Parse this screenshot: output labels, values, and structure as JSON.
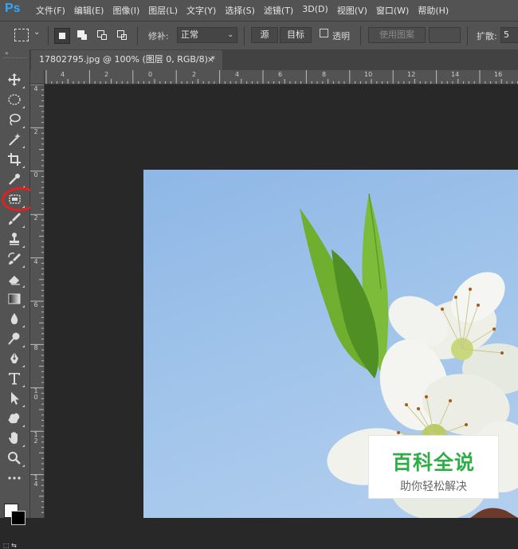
{
  "app": {
    "logo": "Ps"
  },
  "menu": [
    "文件(F)",
    "编辑(E)",
    "图像(I)",
    "图层(L)",
    "文字(Y)",
    "选择(S)",
    "滤镜(T)",
    "3D(D)",
    "视图(V)",
    "窗口(W)",
    "帮助(H)"
  ],
  "options": {
    "patch_label": "修补:",
    "patch_value": "正常",
    "source_label": "源",
    "target_label": "目标",
    "transparent_label": "透明",
    "use_pattern_label": "使用图案",
    "diffusion_label": "扩散:",
    "diffusion_value": "5"
  },
  "document": {
    "tab_title": "17802795.jpg @ 100% (图层 0, RGB/8) *",
    "close": "×"
  },
  "ruler_top": [
    "4",
    "2",
    "0",
    "2",
    "4",
    "6",
    "8",
    "10",
    "12",
    "14",
    "16"
  ],
  "ruler_left": [
    "4",
    "2",
    "0",
    "2",
    "4",
    "6",
    "8",
    "10",
    "12",
    "14"
  ],
  "tools": [
    "move-tool",
    "marquee-tool",
    "lasso-tool",
    "magic-wand-tool",
    "crop-tool",
    "eyedropper-tool",
    "patch-tool",
    "brush-tool",
    "clone-stamp-tool",
    "history-brush-tool",
    "eraser-tool",
    "gradient-tool",
    "blur-tool",
    "dodge-tool",
    "pen-tool",
    "type-tool",
    "path-selection-tool",
    "shape-tool",
    "hand-tool",
    "zoom-tool",
    "more-tools"
  ],
  "colors": {
    "foreground": "#ffffff",
    "background": "#000000",
    "highlight": "#e1201f"
  },
  "watermark": {
    "title": "百科全说",
    "subtitle": "助你轻松解决"
  }
}
